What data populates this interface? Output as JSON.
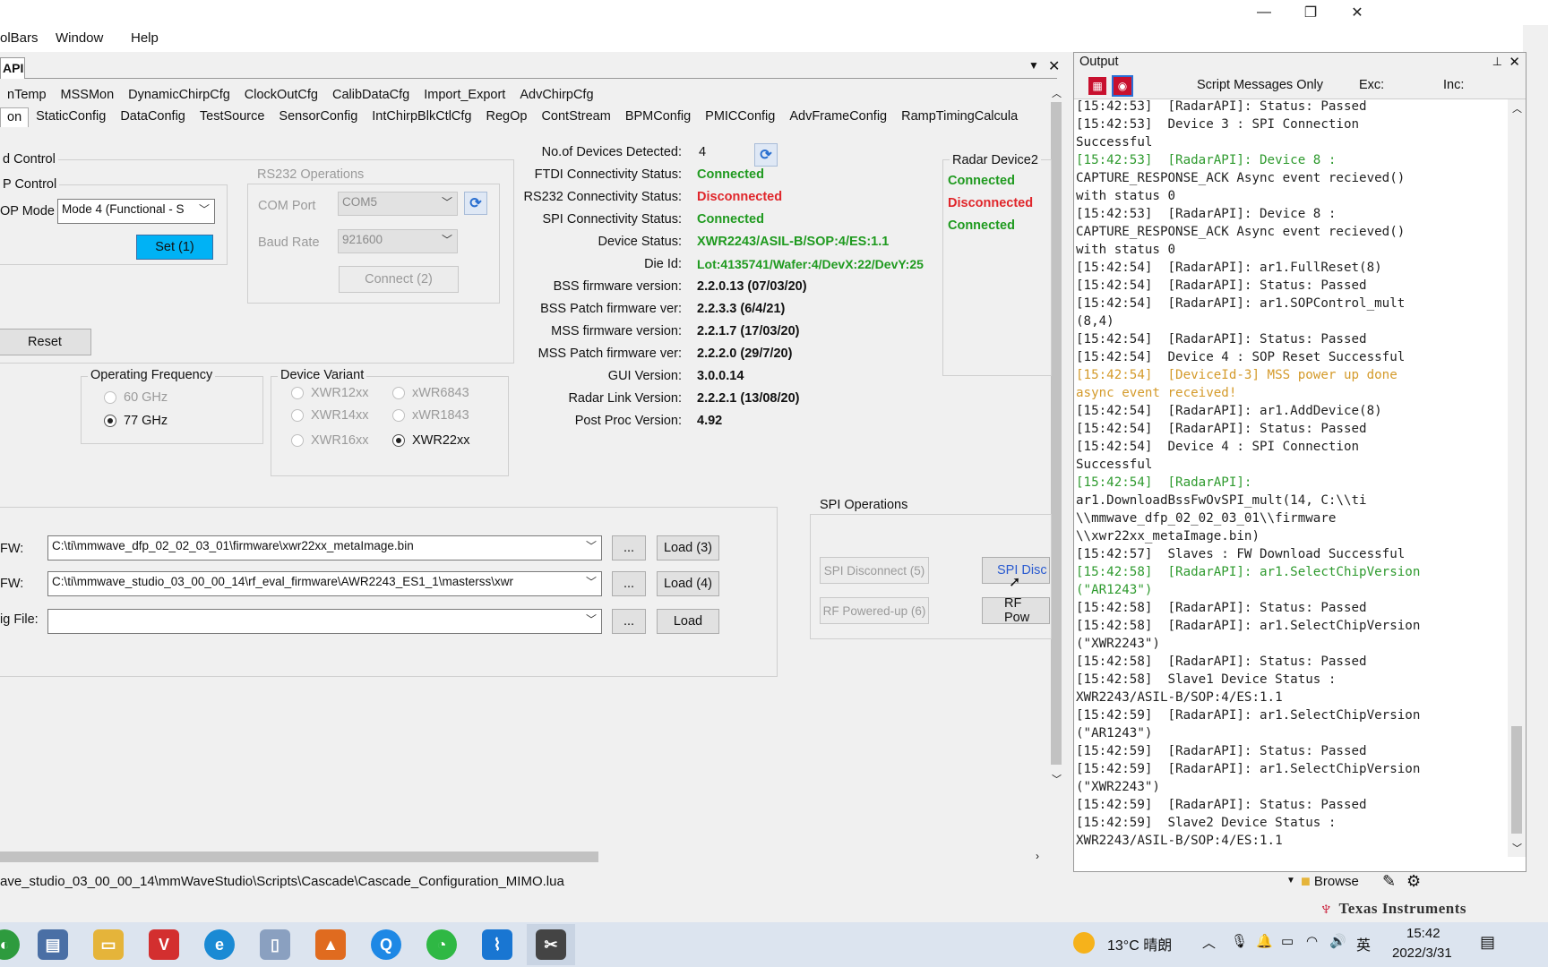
{
  "window": {
    "minimize_glyph": "—",
    "restore_glyph": "❐",
    "close_glyph": "✕"
  },
  "menu": [
    "olBars",
    "Window",
    "Help"
  ],
  "doc_tab": "API",
  "tabs_row1": [
    "nTemp",
    "MSSMon",
    "DynamicChirpCfg",
    "ClockOutCfg",
    "CalibDataCfg",
    "Import_Export",
    "AdvChirpCfg"
  ],
  "tabs_row2": [
    "on",
    "StaticConfig",
    "DataConfig",
    "TestSource",
    "SensorConfig",
    "IntChirpBlkCtlCfg",
    "RegOp",
    "ContStream",
    "BPMConfig",
    "PMICConfig",
    "AdvFrameConfig",
    "RampTimingCalcula"
  ],
  "board_control": {
    "group_label": "d Control",
    "sop_group_label": "P Control",
    "sop_mode_label": "OP Mode",
    "sop_mode_value": "Mode 4 (Functional - S",
    "set_button": "Set (1)",
    "reset_button": "Reset"
  },
  "rs232": {
    "group_label": "RS232 Operations",
    "com_port_label": "COM Port",
    "com_port_value": "COM5",
    "baud_rate_label": "Baud Rate",
    "baud_rate_value": "921600",
    "connect_button": "Connect (2)"
  },
  "status": {
    "rows": [
      {
        "label": "No.of Devices Detected:",
        "value": "4",
        "color": "#111111"
      },
      {
        "label": "FTDI Connectivity Status:",
        "value": "Connected",
        "color": "#1f9a1f"
      },
      {
        "label": "RS232 Connectivity Status:",
        "value": "Disconnected",
        "color": "#e0262b"
      },
      {
        "label": "SPI Connectivity Status:",
        "value": "Connected",
        "color": "#1f9a1f"
      },
      {
        "label": "Device Status:",
        "value": "XWR2243/ASIL-B/SOP:4/ES:1.1",
        "color": "#1f9a1f"
      },
      {
        "label": "Die Id:",
        "value": "Lot:4135741/Wafer:4/DevX:22/DevY:25",
        "color": "#1f9a1f"
      },
      {
        "label": "BSS firmware version:",
        "value": "2.2.0.13 (07/03/20)",
        "color": "#111111"
      },
      {
        "label": "BSS Patch firmware ver:",
        "value": "2.2.3.3 (6/4/21)",
        "color": "#111111"
      },
      {
        "label": "MSS firmware version:",
        "value": "2.2.1.7 (17/03/20)",
        "color": "#111111"
      },
      {
        "label": "MSS Patch firmware ver:",
        "value": "2.2.2.0 (29/7/20)",
        "color": "#111111"
      },
      {
        "label": "GUI Version:",
        "value": "3.0.0.14",
        "color": "#111111"
      },
      {
        "label": "Radar Link Version:",
        "value": "2.2.2.1 (13/08/20)",
        "color": "#111111"
      },
      {
        "label": "Post Proc Version:",
        "value": "4.92",
        "color": "#111111"
      }
    ]
  },
  "radar_device2": {
    "group_label": "Radar Device2",
    "lines": [
      {
        "text": "Connected",
        "color": "#1f9a1f"
      },
      {
        "text": "Disconnected",
        "color": "#e0262b"
      },
      {
        "text": "Connected",
        "color": "#1f9a1f"
      }
    ]
  },
  "operating_frequency": {
    "group_label": "Operating Frequency",
    "options": [
      {
        "label": "60 GHz",
        "selected": false,
        "enabled": false
      },
      {
        "label": "77 GHz",
        "selected": true,
        "enabled": true
      }
    ]
  },
  "device_variant": {
    "group_label": "Device Variant",
    "options": [
      {
        "label": "XWR12xx",
        "selected": false
      },
      {
        "label": "xWR6843",
        "selected": false
      },
      {
        "label": "XWR14xx",
        "selected": false
      },
      {
        "label": "xWR1843",
        "selected": false
      },
      {
        "label": "XWR16xx",
        "selected": false
      },
      {
        "label": "XWR22xx",
        "selected": true
      }
    ]
  },
  "firmware": {
    "rows": [
      {
        "label": "FW:",
        "path": "C:\\ti\\mmwave_dfp_02_02_03_01\\firmware\\xwr22xx_metaImage.bin",
        "browse": "...",
        "button": "Load (3)"
      },
      {
        "label": "FW:",
        "path": "C:\\ti\\mmwave_studio_03_00_00_14\\rf_eval_firmware\\AWR2243_ES1_1\\masterss\\xwr",
        "browse": "...",
        "button": "Load (4)"
      },
      {
        "label": "ig File:",
        "path": "",
        "browse": "...",
        "button": "Load"
      }
    ]
  },
  "spi_operations": {
    "group_label": "SPI Operations",
    "spi_disconnect": "SPI Disconnect (5)",
    "spi_disc_active": "SPI Disc",
    "rf_powered_up": "RF Powered-up (6)",
    "rf_pow": "RF Pow"
  },
  "output": {
    "title": "Output",
    "script_messages_only": "Script Messages Only",
    "exc_label": "Exc:",
    "inc_label": "Inc:",
    "lines": [
      {
        "text": "[15:42:53]  [RadarAPI]: Status: Passed",
        "color": "#222222"
      },
      {
        "text": "[15:42:53]  Device 3 : SPI Connection",
        "color": "#222222"
      },
      {
        "text": "Successful",
        "color": "#222222"
      },
      {
        "text": "[15:42:53]  [RadarAPI]: Device 8 :",
        "color": "#2e9a2e"
      },
      {
        "text": "CAPTURE_RESPONSE_ACK Async event recieved()",
        "color": "#222222"
      },
      {
        "text": "with status 0",
        "color": "#222222"
      },
      {
        "text": "[15:42:53]  [RadarAPI]: Device 8 :",
        "color": "#222222"
      },
      {
        "text": "CAPTURE_RESPONSE_ACK Async event recieved()",
        "color": "#222222"
      },
      {
        "text": "with status 0",
        "color": "#222222"
      },
      {
        "text": "[15:42:54]  [RadarAPI]: ar1.FullReset(8)",
        "color": "#222222"
      },
      {
        "text": "[15:42:54]  [RadarAPI]: Status: Passed",
        "color": "#222222"
      },
      {
        "text": "[15:42:54]  [RadarAPI]: ar1.SOPControl_mult",
        "color": "#222222"
      },
      {
        "text": "(8,4)",
        "color": "#222222"
      },
      {
        "text": "[15:42:54]  [RadarAPI]: Status: Passed",
        "color": "#222222"
      },
      {
        "text": "[15:42:54]  Device 4 : SOP Reset Successful",
        "color": "#222222"
      },
      {
        "text": "[15:42:54]  [DeviceId-3] MSS power up done",
        "color": "#d49a2a"
      },
      {
        "text": "async event received!",
        "color": "#d49a2a"
      },
      {
        "text": "[15:42:54]  [RadarAPI]: ar1.AddDevice(8)",
        "color": "#222222"
      },
      {
        "text": "[15:42:54]  [RadarAPI]: Status: Passed",
        "color": "#222222"
      },
      {
        "text": "[15:42:54]  Device 4 : SPI Connection",
        "color": "#222222"
      },
      {
        "text": "Successful",
        "color": "#222222"
      },
      {
        "text": "[15:42:54]  [RadarAPI]:",
        "color": "#2e9a2e"
      },
      {
        "text": "ar1.DownloadBssFwOvSPI_mult(14, C:\\\\ti",
        "color": "#222222"
      },
      {
        "text": "\\\\mmwave_dfp_02_02_03_01\\\\firmware",
        "color": "#222222"
      },
      {
        "text": "\\\\xwr22xx_metaImage.bin)",
        "color": "#222222"
      },
      {
        "text": "[15:42:57]  Slaves : FW Download Successful",
        "color": "#222222"
      },
      {
        "text": "[15:42:58]  [RadarAPI]: ar1.SelectChipVersion",
        "color": "#2e9a2e"
      },
      {
        "text": "(\"AR1243\")",
        "color": "#2e9a2e"
      },
      {
        "text": "[15:42:58]  [RadarAPI]: Status: Passed",
        "color": "#222222"
      },
      {
        "text": "[15:42:58]  [RadarAPI]: ar1.SelectChipVersion",
        "color": "#222222"
      },
      {
        "text": "(\"XWR2243\")",
        "color": "#222222"
      },
      {
        "text": "[15:42:58]  [RadarAPI]: Status: Passed",
        "color": "#222222"
      },
      {
        "text": "[15:42:58]  Slave1 Device Status :",
        "color": "#222222"
      },
      {
        "text": "XWR2243/ASIL-B/SOP:4/ES:1.1",
        "color": "#222222"
      },
      {
        "text": "[15:42:59]  [RadarAPI]: ar1.SelectChipVersion",
        "color": "#222222"
      },
      {
        "text": "(\"AR1243\")",
        "color": "#222222"
      },
      {
        "text": "[15:42:59]  [RadarAPI]: Status: Passed",
        "color": "#222222"
      },
      {
        "text": "[15:42:59]  [RadarAPI]: ar1.SelectChipVersion",
        "color": "#222222"
      },
      {
        "text": "(\"XWR2243\")",
        "color": "#222222"
      },
      {
        "text": "[15:42:59]  [RadarAPI]: Status: Passed",
        "color": "#222222"
      },
      {
        "text": "[15:42:59]  Slave2 Device Status :",
        "color": "#222222"
      },
      {
        "text": "XWR2243/ASIL-B/SOP:4/ES:1.1",
        "color": "#222222"
      }
    ]
  },
  "statusbar": {
    "script_path": "ave_studio_03_00_00_14\\mmWaveStudio\\Scripts\\Cascade\\Cascade_Configuration_MIMO.lua",
    "browse_label": "Browse",
    "brand": "Texas Instruments"
  },
  "taskbar": {
    "weather": "13°C 晴朗",
    "ime": "英",
    "time": "15:42",
    "date": "2022/3/31",
    "app_icons": [
      "chrome-icon",
      "calculator-icon",
      "file-explorer-icon",
      "vector-icon",
      "edge-icon",
      "notepad-icon",
      "matlab-icon",
      "search-app-icon",
      "wechat-icon",
      "mmwave-icon",
      "snipping-tool-icon"
    ]
  },
  "colors": {
    "connected": "#1f9a1f",
    "disconnected": "#e0262b",
    "set_button": "#00b2f5",
    "log_green": "#2e9a2e",
    "log_orange": "#d49a2a",
    "ti_red": "#c8102e"
  }
}
